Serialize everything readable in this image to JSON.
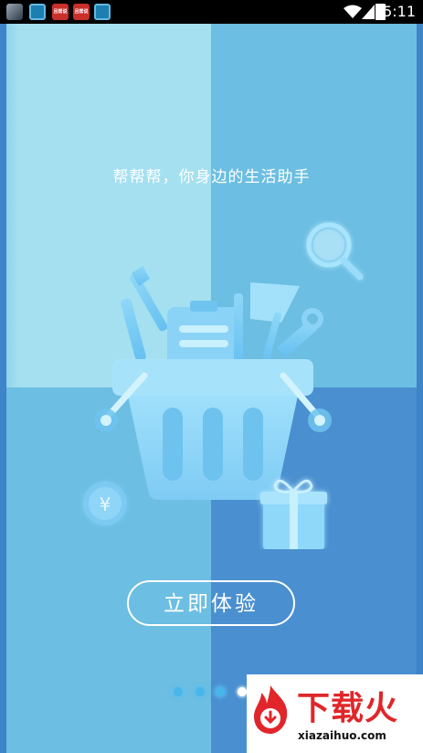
{
  "status_bar": {
    "time": "5:11",
    "notifications": [
      {
        "icon": "app-thumbnail-icon"
      },
      {
        "icon": "app-blue-ring-icon"
      },
      {
        "icon": "app-red-icon",
        "text": "且帮说"
      },
      {
        "icon": "app-red-icon",
        "text": "且帮说"
      },
      {
        "icon": "app-blue-ring-icon"
      }
    ],
    "indicators": [
      "wifi-icon",
      "signal-icon",
      "battery-icon"
    ]
  },
  "onboarding": {
    "tagline": "帮帮帮，你身边的生活助手",
    "cta_label": "立即体验",
    "illustration": "basket-of-tools-illustration",
    "colors": {
      "quadrant_top_left": "#a4e0f0",
      "quadrant_top_right": "#6cbee2",
      "quadrant_bottom_left": "#6cbee2",
      "quadrant_bottom_right": "#4a8fcf"
    },
    "page_indicator": {
      "count": 4,
      "active_index": 3
    }
  },
  "watermark": {
    "title": "下载火",
    "url": "xiazaihuo.com",
    "color": "#e0262a"
  }
}
